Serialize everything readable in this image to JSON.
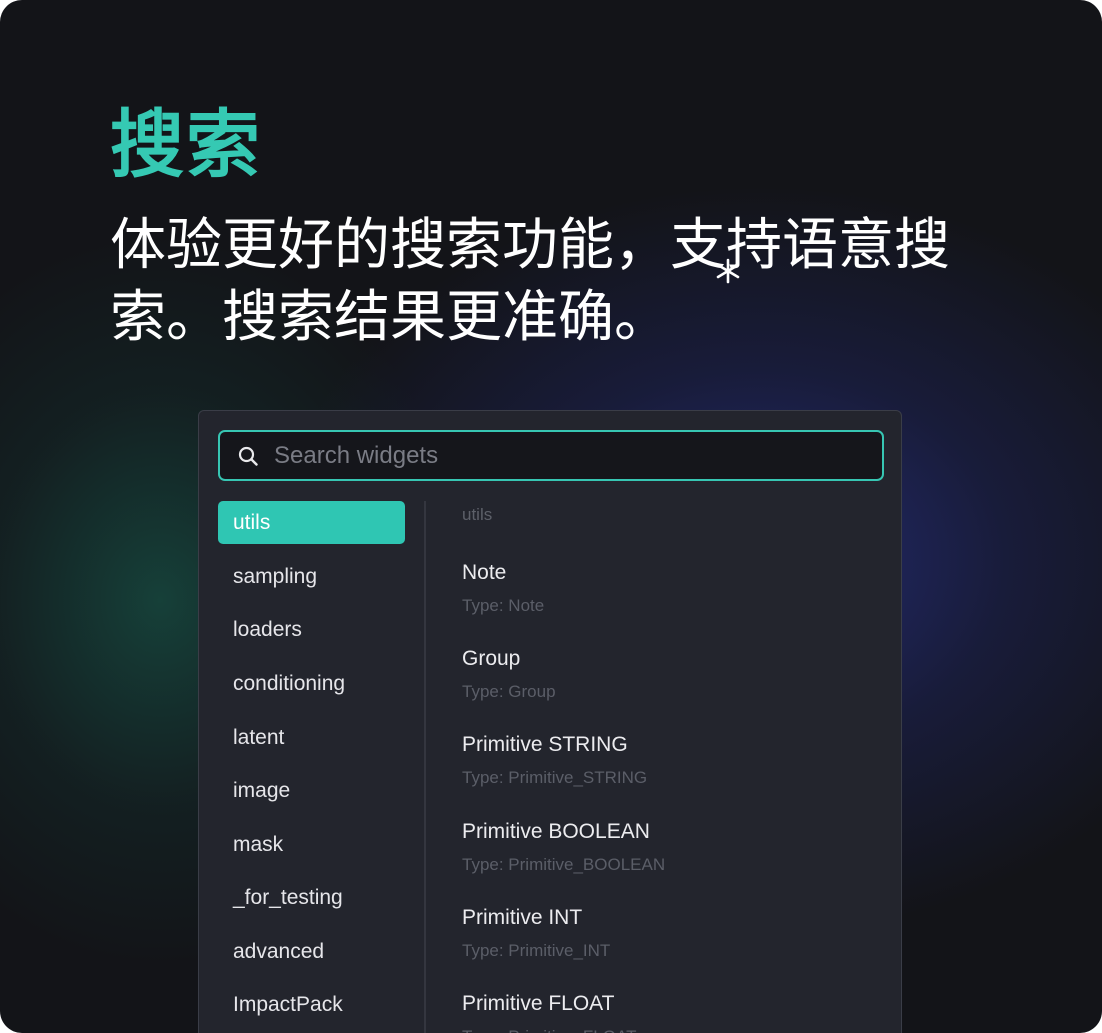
{
  "hero": {
    "title": "搜索",
    "subtitle": "体验更好的搜索功能，支持语意搜索。搜索结果更准确。"
  },
  "search": {
    "placeholder": "Search widgets",
    "value": ""
  },
  "sidebar": {
    "items": [
      {
        "label": "utils",
        "active": true
      },
      {
        "label": "sampling",
        "active": false
      },
      {
        "label": "loaders",
        "active": false
      },
      {
        "label": "conditioning",
        "active": false
      },
      {
        "label": "latent",
        "active": false
      },
      {
        "label": "image",
        "active": false
      },
      {
        "label": "mask",
        "active": false
      },
      {
        "label": "_for_testing",
        "active": false
      },
      {
        "label": "advanced",
        "active": false
      },
      {
        "label": "ImpactPack",
        "active": false
      }
    ]
  },
  "results": {
    "section_label": "utils",
    "items": [
      {
        "title": "Note",
        "type": "Type: Note"
      },
      {
        "title": "Group",
        "type": "Type: Group"
      },
      {
        "title": "Primitive STRING",
        "type": "Type: Primitive_STRING"
      },
      {
        "title": "Primitive BOOLEAN",
        "type": "Type: Primitive_BOOLEAN"
      },
      {
        "title": "Primitive INT",
        "type": "Type: Primitive_INT"
      },
      {
        "title": "Primitive FLOAT",
        "type": "Type: Primitive_FLOAT"
      }
    ]
  },
  "icons": {
    "search": "search-icon",
    "cursor": "text-cursor-icon"
  },
  "colors": {
    "accent": "#2fc6b3",
    "title": "#35c9b3",
    "panel": "#23252d",
    "background": "#131418"
  }
}
